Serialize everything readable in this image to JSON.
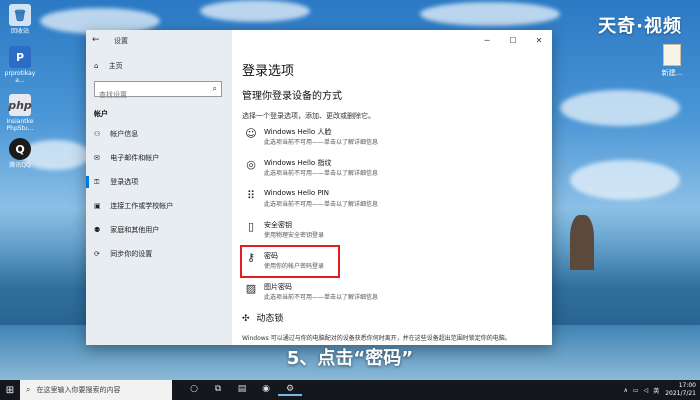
{
  "desktop": {
    "icons": [
      {
        "label": "回收站",
        "icon": "recycle-bin-icon"
      },
      {
        "label": "prprotikay a...",
        "icon": "powerpoint-icon"
      },
      {
        "label": "Insiantke PhpStu...",
        "icon": "php-icon"
      },
      {
        "label": "腾讯QQ",
        "icon": "qq-icon"
      }
    ],
    "right_icon": {
      "label": "新建...",
      "icon": "document-icon"
    }
  },
  "watermark": "天奇·视频",
  "caption": "5、点击“密码”",
  "window": {
    "title": "设置",
    "controls": {
      "minimize": "─",
      "maximize": "☐",
      "close": "✕"
    },
    "sidebar": {
      "home_label": "主页",
      "search_placeholder": "查找设置",
      "section_label": "帐户",
      "items": [
        {
          "label": "帐户信息",
          "icon": "person-icon",
          "selected": false
        },
        {
          "label": "电子邮件和帐户",
          "icon": "mail-icon",
          "selected": false
        },
        {
          "label": "登录选项",
          "icon": "key-icon",
          "selected": true
        },
        {
          "label": "连接工作或学校帐户",
          "icon": "briefcase-icon",
          "selected": false
        },
        {
          "label": "家庭和其他用户",
          "icon": "people-icon",
          "selected": false
        },
        {
          "label": "同步你的设置",
          "icon": "sync-icon",
          "selected": false
        }
      ]
    },
    "content": {
      "heading": "登录选项",
      "subheading": "管理你登录设备的方式",
      "description": "选择一个登录选项，添加、更改或删除它。",
      "options": [
        {
          "title": "Windows Hello 人脸",
          "subtitle": "此选项当前不可用——单击以了解详细信息",
          "icon": "face-icon"
        },
        {
          "title": "Windows Hello 指纹",
          "subtitle": "此选项当前不可用——单击以了解详细信息",
          "icon": "fingerprint-icon"
        },
        {
          "title": "Windows Hello PIN",
          "subtitle": "此选项当前不可用——单击以了解详细信息",
          "icon": "pin-keypad-icon"
        },
        {
          "title": "安全密钥",
          "subtitle": "使用物理安全密钥登录",
          "icon": "usb-key-icon"
        },
        {
          "title": "密码",
          "subtitle": "使用你的帐户密码登录",
          "icon": "key-icon",
          "highlighted": true
        },
        {
          "title": "图片密码",
          "subtitle": "此选项当前不可用——单击以了解详细信息",
          "icon": "picture-icon"
        }
      ],
      "dynamic_lock": {
        "title": "动态锁",
        "description": "Windows 可以通过与你的电脑配对的设备获悉你何时离开，并在这些设备超出范围时锁定你的电脑。"
      }
    }
  },
  "taskbar": {
    "search_placeholder": "在这里输入你要搜索的内容",
    "time": "17:00",
    "date": "2021/7/21",
    "tray_text": "英"
  },
  "colors": {
    "accent": "#0078d7",
    "highlight_box": "#e02020",
    "sidebar_bg": "#e8edf2",
    "taskbar_bg": "#14171c"
  }
}
